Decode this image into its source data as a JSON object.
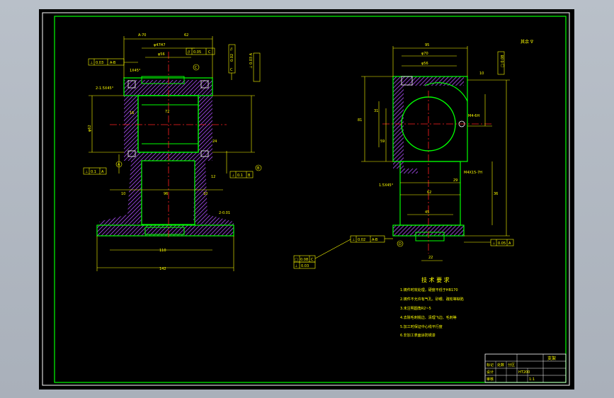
{
  "colors": {
    "background": "#000000",
    "frame": "#00ff00",
    "part_outline": "#00ff00",
    "dimension": "#ffff00",
    "hatch": "#b050ff",
    "centerline": "#ff2020",
    "text": "#ffff00"
  },
  "drawing": {
    "roughness_note": "其余 ∇",
    "left_view": {
      "dims_top": [
        "A-70",
        "62",
        "φ47H7",
        "φ56"
      ],
      "dims_side": [
        "16",
        "72",
        "φ62",
        "24",
        "12",
        "10",
        "10",
        "96",
        "110",
        "142"
      ],
      "callouts": [
        "1X45°",
        "2-1.5X45°",
        "2-0.01"
      ],
      "frames": [
        [
          "⊥",
          "0.03",
          "A-B"
        ],
        [
          "//",
          "0.05",
          "C"
        ],
        [
          "⊥",
          "0.1",
          "A"
        ],
        [
          "⊥",
          "0.1",
          "B"
        ],
        [
          "//",
          "0.02",
          "C"
        ]
      ],
      "datums": [
        "A",
        "B",
        "C"
      ]
    },
    "right_view": {
      "dims_top": [
        "95",
        "φ70",
        "φ56"
      ],
      "dims_side": [
        "81",
        "31",
        "59",
        "29",
        "62",
        "45",
        "36",
        "10",
        "22"
      ],
      "callouts": [
        "1.5X45°",
        "M4-6H",
        "M4X15-7H"
      ],
      "frames": [
        [
          "⊥",
          "0.02",
          "A-B"
        ],
        [
          "⊥",
          "0.05",
          "A"
        ],
        [
          "□",
          "0.08",
          "C"
        ],
        [
          "⊥",
          "0.03",
          "D"
        ]
      ],
      "datums": [
        "D"
      ]
    }
  },
  "tech_requirements": {
    "title": "技 术 要 求",
    "items": [
      "1.铸件时效处理，硬度不低于HB170",
      "2.铸件不允许有气孔、砂眼、疏松等缺陷",
      "3.未注明圆角R2~5",
      "4.去除毛刺锐边、清理飞边、毛刺等",
      "5.加工时保证中心线平行度",
      "6.非加工表面涂防锈漆"
    ]
  },
  "title_block": {
    "part_name": "支架",
    "material": "HT200",
    "scale": "1:1",
    "labels": [
      "标记",
      "处数",
      "分区",
      "更改文件号",
      "签名",
      "日期",
      "设计",
      "审核",
      "工艺",
      "批准"
    ]
  }
}
